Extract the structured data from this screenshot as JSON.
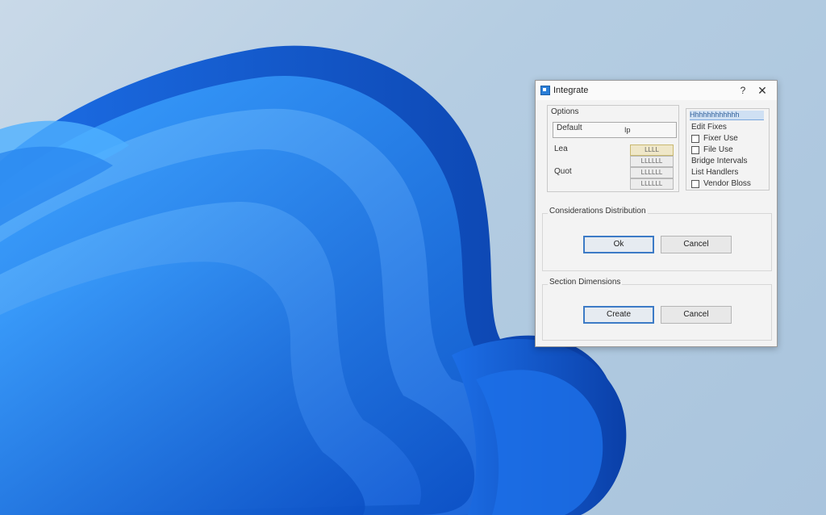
{
  "dialog": {
    "title": "Integrate",
    "help_label": "?",
    "close_label": "✕",
    "options": {
      "label": "Options",
      "input_value": "Default",
      "input_suffix": "Ip",
      "rows": [
        {
          "label": "Lea",
          "value": "LLLL"
        },
        {
          "label": "Quot",
          "value": "LLLLLL"
        },
        {
          "label": "",
          "value": "LLLLLL"
        },
        {
          "label": "",
          "value": "LLLLLL"
        }
      ]
    },
    "checklist": {
      "header": "Hhhhhhhhhhhh",
      "items": [
        {
          "label": "Edit Fixes",
          "checkbox": false
        },
        {
          "label": "Fixer Use",
          "checkbox": true
        },
        {
          "label": "File Use",
          "checkbox": true
        },
        {
          "label": "Bridge Intervals",
          "checkbox": false
        },
        {
          "label": "List Handlers",
          "checkbox": false
        },
        {
          "label": "Vendor Bloss",
          "checkbox": true
        }
      ]
    },
    "group1": {
      "title": "Considerations Distribution",
      "ok_label": "Ok",
      "cancel_label": "Cancel"
    },
    "group2": {
      "title": "Section Dimensions",
      "ok_label": "Create",
      "cancel_label": "Cancel"
    }
  },
  "colors": {
    "accent": "#3d7bc6",
    "wallpaper_blue": "#1f6fe0"
  }
}
